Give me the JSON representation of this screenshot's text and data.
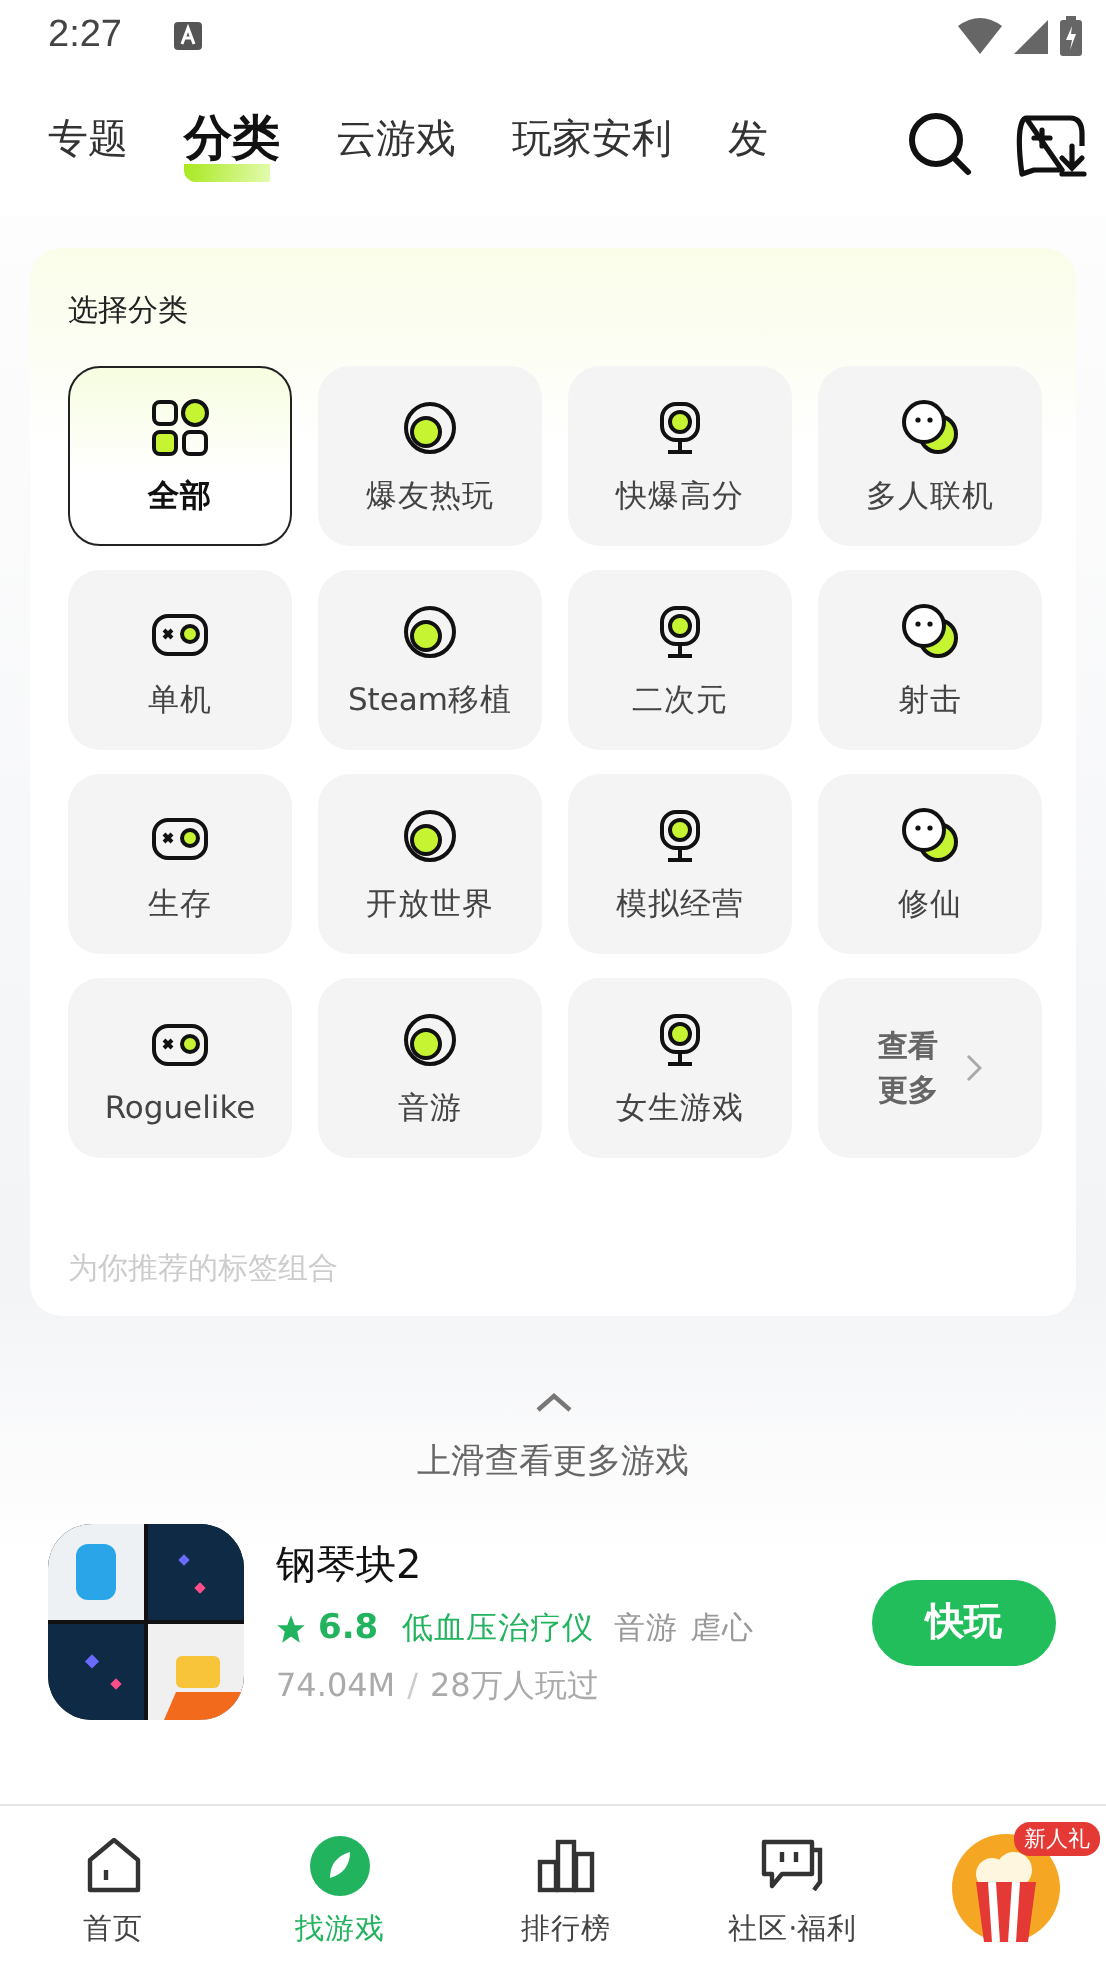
{
  "status_bar": {
    "time": "2:27"
  },
  "tabs": [
    {
      "label": "专题",
      "selected": false
    },
    {
      "label": "分类",
      "selected": true
    },
    {
      "label": "云游戏",
      "selected": false
    },
    {
      "label": "玩家安利",
      "selected": false
    },
    {
      "label": "发",
      "selected": false
    }
  ],
  "category_panel": {
    "title": "选择分类",
    "categories": [
      {
        "label": "全部",
        "selected": true
      },
      {
        "label": "爆友热玩",
        "selected": false
      },
      {
        "label": "快爆高分",
        "selected": false
      },
      {
        "label": "多人联机",
        "selected": false
      },
      {
        "label": "单机",
        "selected": false
      },
      {
        "label": "Steam移植",
        "selected": false
      },
      {
        "label": "二次元",
        "selected": false
      },
      {
        "label": "射击",
        "selected": false
      },
      {
        "label": "生存",
        "selected": false
      },
      {
        "label": "开放世界",
        "selected": false
      },
      {
        "label": "模拟经营",
        "selected": false
      },
      {
        "label": "修仙",
        "selected": false
      },
      {
        "label": "Roguelike",
        "selected": false
      },
      {
        "label": "音游",
        "selected": false
      },
      {
        "label": "女生游戏",
        "selected": false
      }
    ],
    "more": {
      "line_1": "查看",
      "line_2": "更多"
    },
    "recommend_heading": "为你推荐的标签组合"
  },
  "swipe_hint": "上滑查看更多游戏",
  "game": {
    "title": "钢琴块2",
    "rating": "6.8",
    "tags": [
      {
        "label": "低血压治疗仪",
        "kind": "highlight"
      },
      {
        "label": "音游",
        "kind": "plain"
      },
      {
        "label": "虐心",
        "kind": "plain"
      }
    ],
    "size": "74.04M",
    "separator": "/",
    "players": "28万人玩过",
    "button": "快玩"
  },
  "bottom_nav": [
    {
      "label": "首页",
      "selected": false
    },
    {
      "label": "找游戏",
      "selected": true
    },
    {
      "label": "排行榜",
      "selected": false
    },
    {
      "label": "社区·福利",
      "selected": false
    }
  ],
  "gift_badge": "新人礼"
}
